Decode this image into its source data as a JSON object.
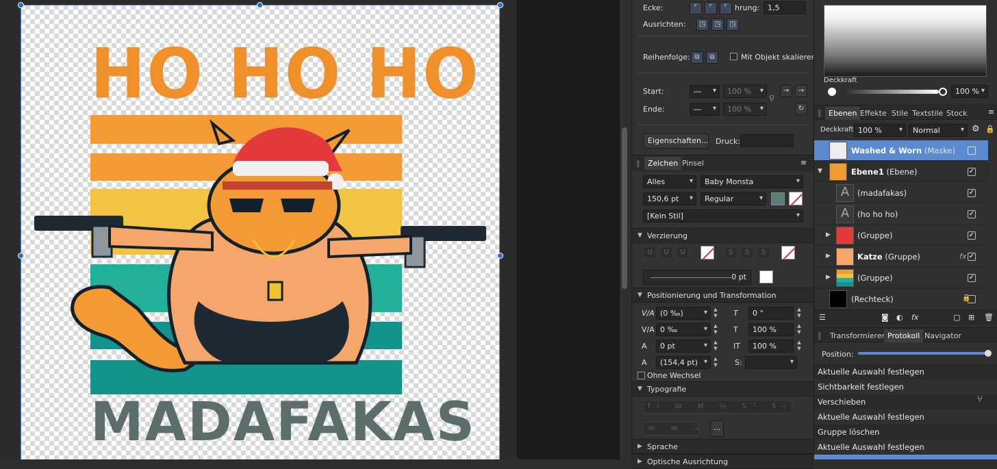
{
  "canvas": {
    "title_text": "HO HO HO",
    "bottom_text": "MADAFAKAS",
    "stripe_colors": [
      "#f39a34",
      "#f3c344",
      "#22b09a",
      "#14938d",
      "#5f6f6c"
    ]
  },
  "mid_panel": {
    "ecke_label": "Ecke:",
    "verschiebung_label": "hrung:",
    "verschiebung_value": "1,5",
    "ausrichten_label": "Ausrichten:",
    "reihenfolge_label": "Reihenfolge:",
    "mit_objekt_label": "Mit Objekt skalieren",
    "start_label": "Start:",
    "ende_label": "Ende:",
    "start_pct": "100 %",
    "ende_pct": "100 %",
    "eigenschaften_button": "Eigenschaften...",
    "druck_label": "Druck:",
    "tabs": [
      "Zeichen",
      "Pinsel"
    ],
    "font_scope": "Alles",
    "font_family": "Baby Monsta",
    "font_size": "150,6 pt",
    "font_style": "Regular",
    "paragraph_style": "[Kein Stil]",
    "verzierung_title": "Verzierung",
    "underline_glyph": "U",
    "strike_glyph": "S",
    "stroke_value": "0 pt",
    "pos_title": "Positionierung und Transformation",
    "kerning": "(0 ‰)",
    "tracking": "0 ‰",
    "baseline": "0 pt",
    "leading": "(154,4 pt)",
    "skew": "0 °",
    "hscale": "100 %",
    "vscale": "100 %",
    "s_label": "S:",
    "ohne_wechsel": "Ohne Wechsel",
    "typografie_title": "Typografie",
    "more_button": "...",
    "sprache_title": "Sprache",
    "optische_title": "Optische Ausrichtung"
  },
  "right_panel": {
    "deckkraft_label": "Deckkraft",
    "deckkraft_value": "100 %",
    "tabs": [
      "Ebenen",
      "Effekte",
      "Stile",
      "Textstile",
      "Stock"
    ],
    "layer_opacity_label": "Deckkraft:",
    "layer_opacity_value": "100 %",
    "blend_mode": "Normal",
    "layers": [
      {
        "name": "Washed & Worn",
        "type": "(Maske)",
        "selected": true
      },
      {
        "name": "Ebene1",
        "type": "(Ebene)"
      },
      {
        "name": "",
        "type": "(madafakas)"
      },
      {
        "name": "",
        "type": "(ho ho ho)"
      },
      {
        "name": "",
        "type": "(Gruppe)"
      },
      {
        "name": "Katze",
        "type": "(Gruppe)"
      },
      {
        "name": "",
        "type": "(Gruppe)"
      },
      {
        "name": "",
        "type": "(Rechteck)"
      }
    ],
    "fx_label": "fx",
    "bottom_tabs": [
      "Transformieren",
      "Protokoll",
      "Navigator"
    ],
    "position_label": "Position:",
    "history": [
      "Aktuelle Auswahl festlegen",
      "Sichtbarkeit festlegen",
      "Verschieben",
      "Aktuelle Auswahl festlegen",
      "Gruppe löschen",
      "Aktuelle Auswahl festlegen"
    ]
  }
}
